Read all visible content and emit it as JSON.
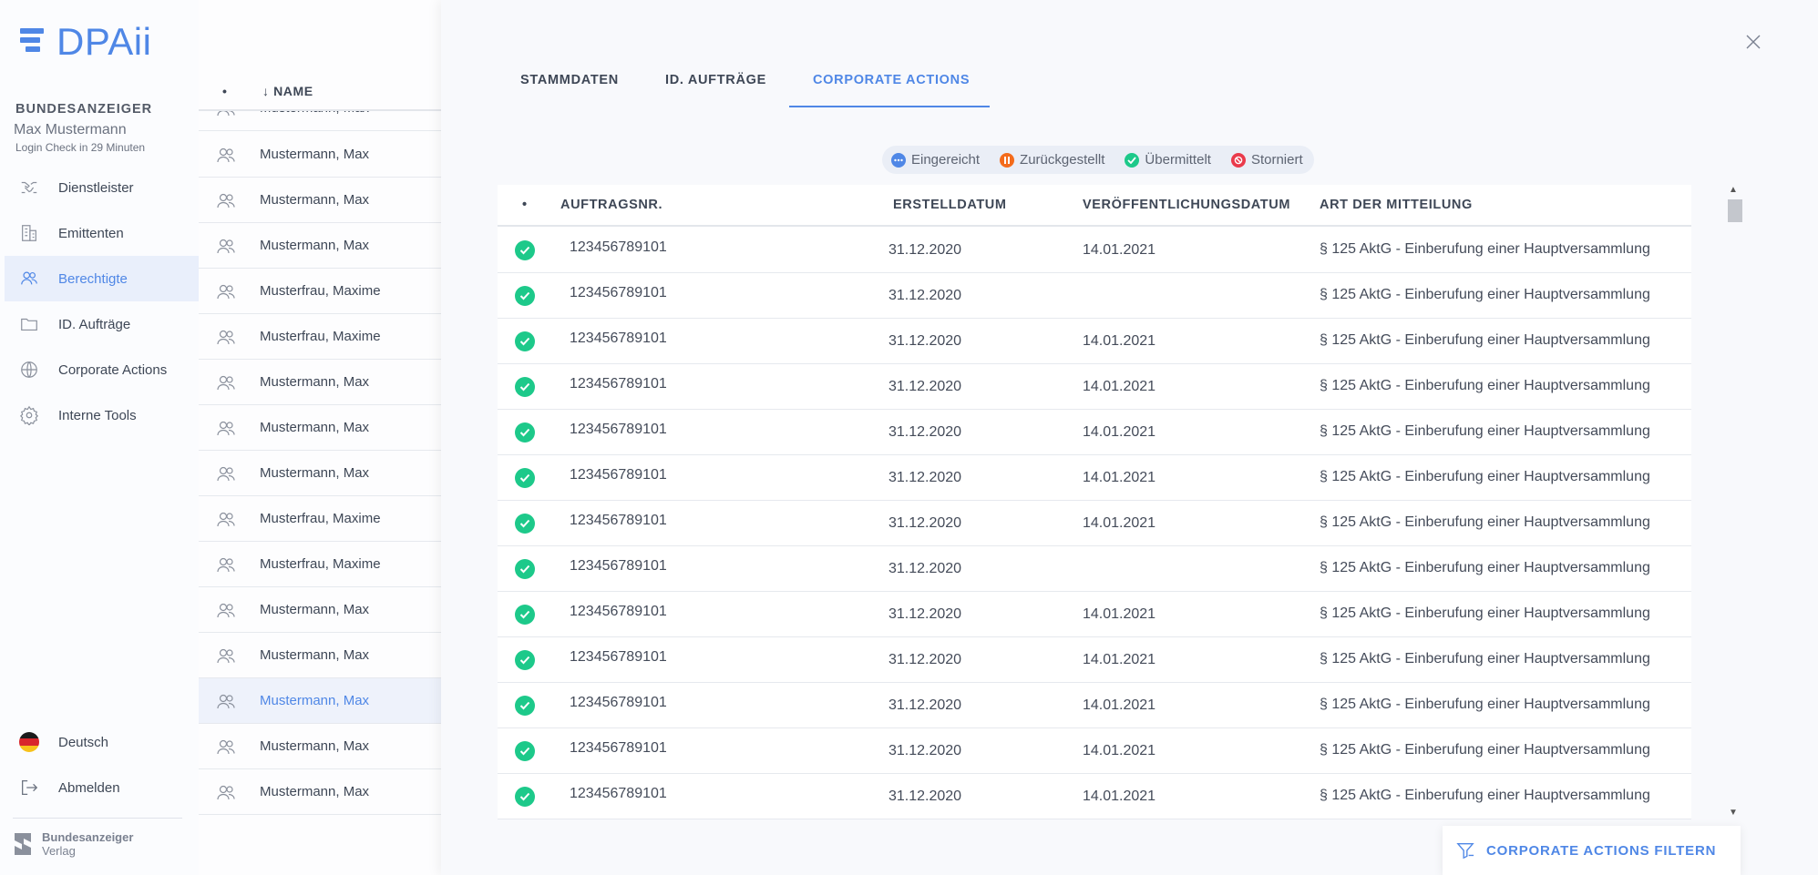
{
  "app": {
    "name": "DPAii"
  },
  "account": {
    "org": "BUNDESANZEIGER",
    "user": "Max Mustermann",
    "login_check": "Login Check in 29 Minuten"
  },
  "nav": [
    {
      "label": "Dienstleister",
      "icon": "handshake-icon",
      "active": false
    },
    {
      "label": "Emittenten",
      "icon": "building-icon",
      "active": false
    },
    {
      "label": "Berechtigte",
      "icon": "users-icon",
      "active": true
    },
    {
      "label": "ID. Aufträge",
      "icon": "folder-icon",
      "active": false
    },
    {
      "label": "Corporate Actions",
      "icon": "globe-icon",
      "active": false
    },
    {
      "label": "Interne Tools",
      "icon": "gear-icon",
      "active": false
    }
  ],
  "bottom": {
    "language": "Deutsch",
    "logout": "Abmelden"
  },
  "footer": {
    "line1": "Bundesanzeiger",
    "line2": "Verlag"
  },
  "namelist": {
    "header_dot": "•",
    "header_name": "↓ NAME",
    "partial_top": "Mustermann, Max",
    "rows": [
      "Mustermann, Max",
      "Mustermann, Max",
      "Mustermann, Max",
      "Musterfrau, Maxime",
      "Musterfrau, Maxime",
      "Mustermann, Max",
      "Mustermann, Max",
      "Mustermann, Max",
      "Musterfrau, Maxime",
      "Musterfrau, Maxime",
      "Mustermann, Max",
      "Mustermann, Max",
      "Mustermann, Max",
      "Mustermann, Max",
      "Mustermann, Max"
    ],
    "selected_index": 12
  },
  "panel": {
    "tabs": [
      "STAMMDATEN",
      "ID. AUFTRÄGE",
      "CORPORATE ACTIONS"
    ],
    "active_tab": 2,
    "legend": [
      {
        "label": "Eingereicht",
        "color": "#4f87e6",
        "icon": "dots-icon"
      },
      {
        "label": "Zurückgestellt",
        "color": "#f46b1b",
        "icon": "pause-icon"
      },
      {
        "label": "Übermittelt",
        "color": "#1dc98a",
        "icon": "check-icon"
      },
      {
        "label": "Storniert",
        "color": "#ea3a4b",
        "icon": "cancel-icon"
      }
    ],
    "table": {
      "headers": [
        "•",
        "AUFTRAGSNR.",
        "ERSTELLDATUM",
        "VERÖFFENTLICHUNGSDATUM",
        "ART DER MITTEILUNG"
      ],
      "rows": [
        {
          "nr": "123456789101",
          "created": "31.12.2020",
          "published": "14.01.2021",
          "type": "§ 125 AktG - Einberufung einer Hauptversammlung"
        },
        {
          "nr": "123456789101",
          "created": "31.12.2020",
          "published": "",
          "type": "§ 125 AktG - Einberufung einer Hauptversammlung"
        },
        {
          "nr": "123456789101",
          "created": "31.12.2020",
          "published": "14.01.2021",
          "type": "§ 125 AktG - Einberufung einer Hauptversammlung"
        },
        {
          "nr": "123456789101",
          "created": "31.12.2020",
          "published": "14.01.2021",
          "type": "§ 125 AktG - Einberufung einer Hauptversammlung"
        },
        {
          "nr": "123456789101",
          "created": "31.12.2020",
          "published": "14.01.2021",
          "type": "§ 125 AktG - Einberufung einer Hauptversammlung"
        },
        {
          "nr": "123456789101",
          "created": "31.12.2020",
          "published": "14.01.2021",
          "type": "§ 125 AktG - Einberufung einer Hauptversammlung"
        },
        {
          "nr": "123456789101",
          "created": "31.12.2020",
          "published": "14.01.2021",
          "type": "§ 125 AktG - Einberufung einer Hauptversammlung"
        },
        {
          "nr": "123456789101",
          "created": "31.12.2020",
          "published": "",
          "type": "§ 125 AktG - Einberufung einer Hauptversammlung"
        },
        {
          "nr": "123456789101",
          "created": "31.12.2020",
          "published": "14.01.2021",
          "type": "§ 125 AktG - Einberufung einer Hauptversammlung"
        },
        {
          "nr": "123456789101",
          "created": "31.12.2020",
          "published": "14.01.2021",
          "type": "§ 125 AktG - Einberufung einer Hauptversammlung"
        },
        {
          "nr": "123456789101",
          "created": "31.12.2020",
          "published": "14.01.2021",
          "type": "§ 125 AktG - Einberufung einer Hauptversammlung"
        },
        {
          "nr": "123456789101",
          "created": "31.12.2020",
          "published": "14.01.2021",
          "type": "§ 125 AktG - Einberufung einer Hauptversammlung"
        },
        {
          "nr": "123456789101",
          "created": "31.12.2020",
          "published": "14.01.2021",
          "type": "§ 125 AktG - Einberufung einer Hauptversammlung"
        }
      ]
    },
    "filter_button": "CORPORATE ACTIONS FILTERN"
  },
  "colors": {
    "accent": "#4f87e6",
    "success": "#1dc98a"
  }
}
